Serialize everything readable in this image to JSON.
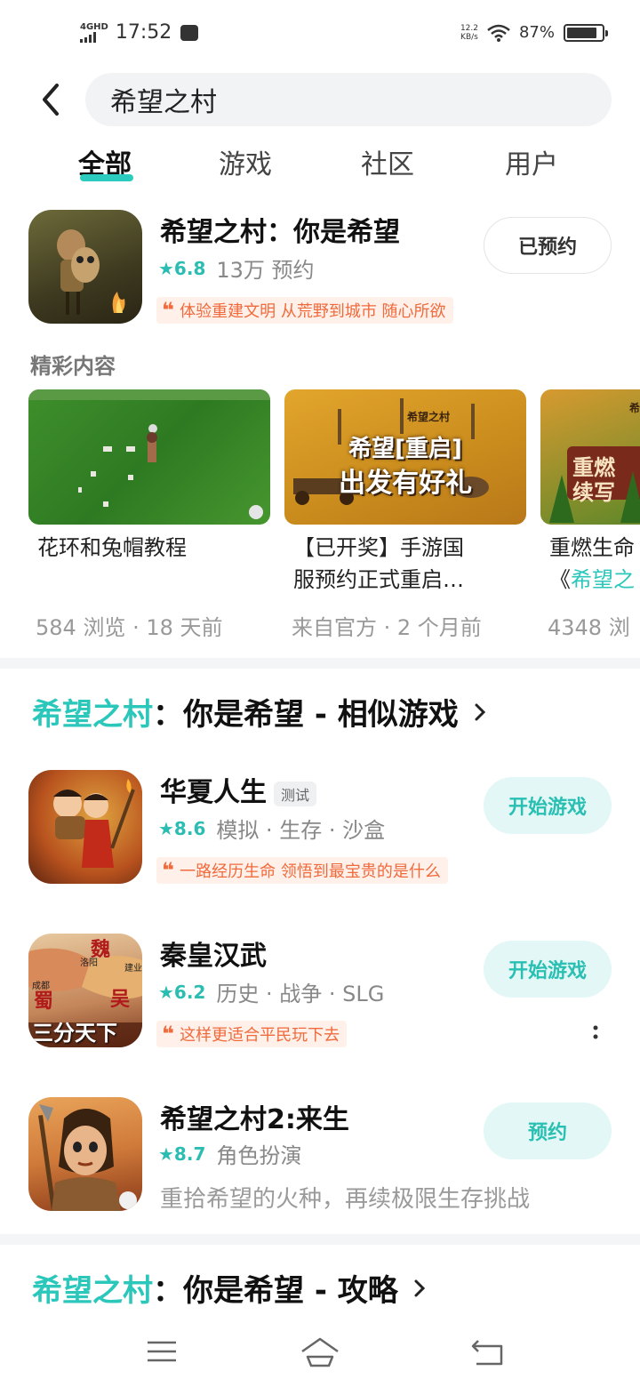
{
  "status_bar": {
    "network": "4GHD",
    "time": "17:52",
    "speed_value": "12.2",
    "speed_unit": "KB/s",
    "battery": "87%",
    "battery_level": 0.87
  },
  "search": {
    "query": "希望之村"
  },
  "tabs": [
    {
      "label": "全部",
      "active": true
    },
    {
      "label": "游戏",
      "active": false
    },
    {
      "label": "社区",
      "active": false
    },
    {
      "label": "用户",
      "active": false
    }
  ],
  "top_app": {
    "title": "希望之村：你是希望",
    "rating": "★6.8",
    "meta": "13万 预约",
    "quote": "体验重建文明 从荒野到城市 随心所欲",
    "button": "已预约"
  },
  "highlights": {
    "title": "精彩内容",
    "items": [
      {
        "line1": "花环和兔帽教程",
        "line2": "",
        "meta": "584 浏览 · 18 天前"
      },
      {
        "line1": "【已开奖】手游国",
        "line2": "服预约正式重启…",
        "meta": "来自官方 · 2 个月前"
      },
      {
        "line1": "重燃生命",
        "line2_prefix": "《",
        "line2_accent": "希望之",
        "meta": "4348 浏"
      }
    ],
    "thumb2_text": {
      "brand": "希望之村",
      "line1": "希望[重启]",
      "line2": "出发有好礼"
    },
    "thumb3_text": {
      "brand": "希",
      "line1": "重燃",
      "line2": "续写"
    }
  },
  "similar": {
    "title_accent": "希望之村",
    "title_rest": "：你是希望 - 相似游戏",
    "apps": [
      {
        "title": "华夏人生",
        "badge": "测试",
        "rating": "★8.6",
        "meta": "模拟 · 生存 · 沙盒",
        "quote": "一路经历生命 领悟到最宝贵的是什么",
        "button": "开始游戏"
      },
      {
        "title": "秦皇汉武",
        "badge": "",
        "rating": "★6.2",
        "meta": "历史 · 战争 · SLG",
        "quote": "这样更适合平民玩下去",
        "button": "开始游戏",
        "icon_text": {
          "a": "魏",
          "b": "蜀",
          "c": "吴",
          "d": "洛阳",
          "e": "成都",
          "f": "建业",
          "g": "三分天下"
        }
      },
      {
        "title": "希望之村2:来生",
        "badge": "",
        "rating": "★8.7",
        "meta": "角色扮演",
        "desc": "重拾希望的火种，再续极限生存挑战",
        "button": "预约"
      }
    ]
  },
  "guide": {
    "title_accent": "希望之村",
    "title_rest": "：你是希望 - 攻略"
  },
  "colors": {
    "accent": "#2cc7bb",
    "quote": "#f06a3c",
    "button_bg": "#e3f8f6"
  }
}
